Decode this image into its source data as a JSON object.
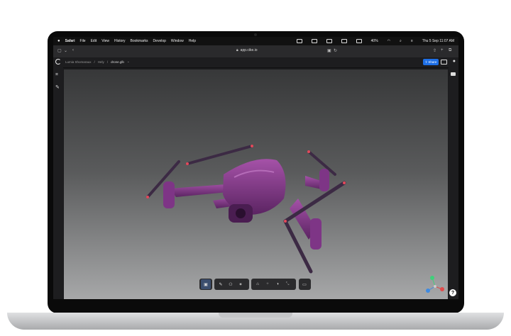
{
  "menubar": {
    "apple": "",
    "items": [
      "Safari",
      "File",
      "Edit",
      "View",
      "History",
      "Bookmarks",
      "Develop",
      "Window",
      "Help"
    ],
    "battery": "40%",
    "clock": "Thu 5 Sep  11:07 AM"
  },
  "safari": {
    "url": "app.cike.io"
  },
  "app": {
    "breadcrumbs": [
      "Lumia Shomaraux",
      "Hely",
      "drone.glb"
    ],
    "share_label": "Share"
  },
  "toolbar": {
    "groups": [
      [
        "select-tool",
        "0"
      ],
      [
        "pen-tool",
        "annotate-tool",
        "light-tool"
      ],
      [
        "home-view",
        "crosshair-tool",
        "material-tool",
        "measure-tool"
      ],
      [
        "camera-tool"
      ]
    ]
  },
  "help_label": "?",
  "colors": {
    "drone": "#8c3f8f",
    "drone_dark": "#5a2361",
    "accent_tip": "#e34a5a",
    "share": "#1e6fe6"
  }
}
